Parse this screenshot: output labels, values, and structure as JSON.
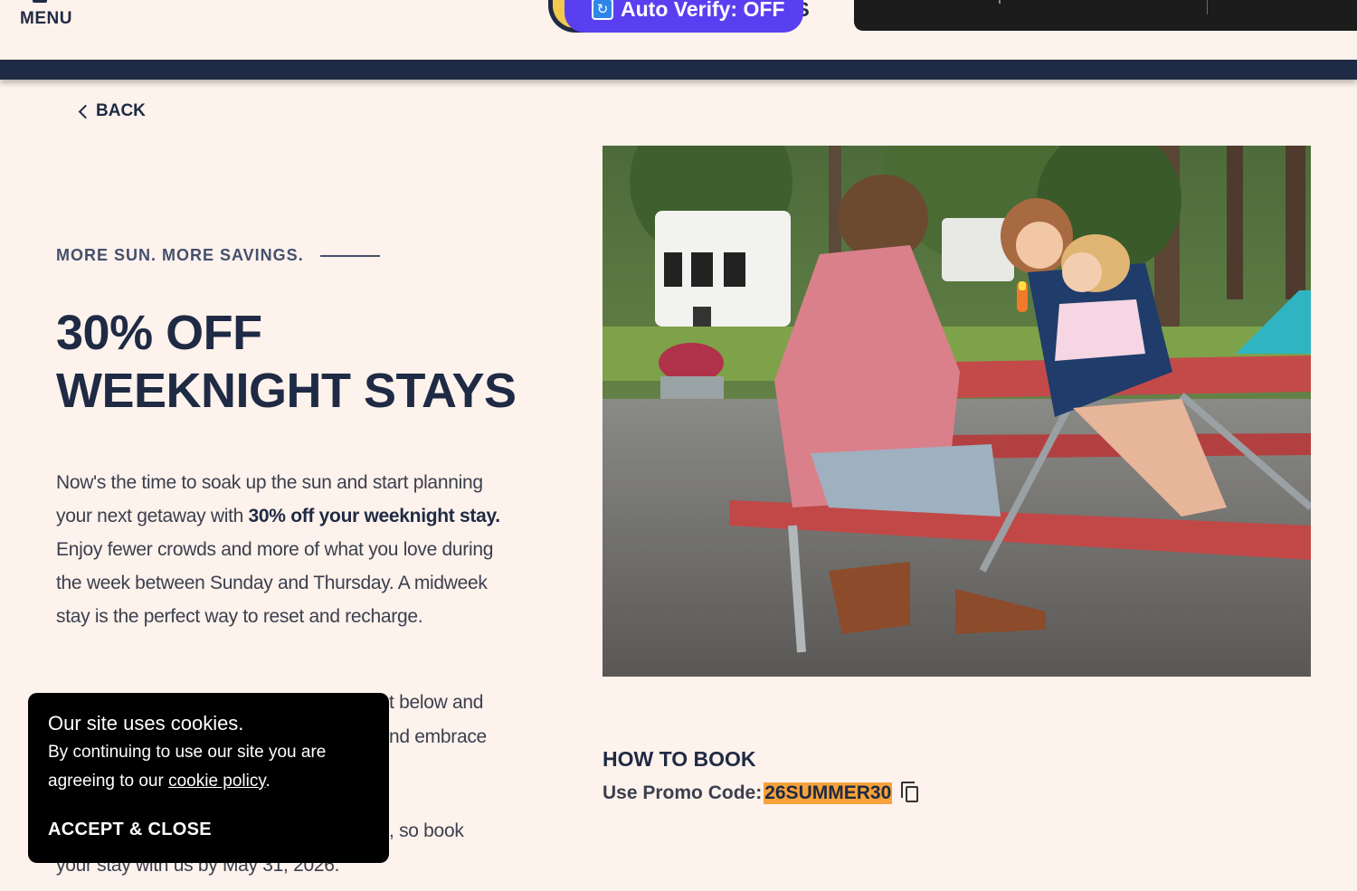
{
  "header": {
    "menu_label": "MENU",
    "auto_verify_label": "Auto Verify: OFF",
    "logo_right_char": "S"
  },
  "back_label": "BACK",
  "hero": {
    "eyebrow": "MORE SUN. MORE SAVINGS.",
    "headline_line1": "30% OFF",
    "headline_line2": "WEEKNIGHT STAYS"
  },
  "body": {
    "p1_part1": "Now's the time to soak up the sun and start planning your next getaway with ",
    "p1_bold": "30% off your weeknight stay.",
    "p1_part2": " Enjoy fewer crowds and more of what you love during the week between Sunday and Thursday. A midweek stay is the perfect way to reset and recharge.",
    "p2_line1_visible": "t below and",
    "p2_line2_visible": "nd embrace",
    "p3_line1_visible": ", so book",
    "p3_line2": "your stay with us by May 31, 2026."
  },
  "how_to_book": {
    "title": "HOW TO BOOK",
    "promo_label": "Use Promo Code:",
    "promo_code": "26SUMMER30"
  },
  "cookie_banner": {
    "title": "Our site uses cookies.",
    "message_before_link": "By continuing to use our site you are agreeing to our ",
    "link_text": "cookie policy",
    "message_after_link": ".",
    "accept_label": "ACCEPT & CLOSE"
  },
  "colors": {
    "page_bg": "#fdf2ec",
    "navy": "#1f2a44",
    "verify_purple": "#5a3ff0",
    "promo_highlight": "#f7a23b",
    "cookie_bg": "#000000"
  }
}
